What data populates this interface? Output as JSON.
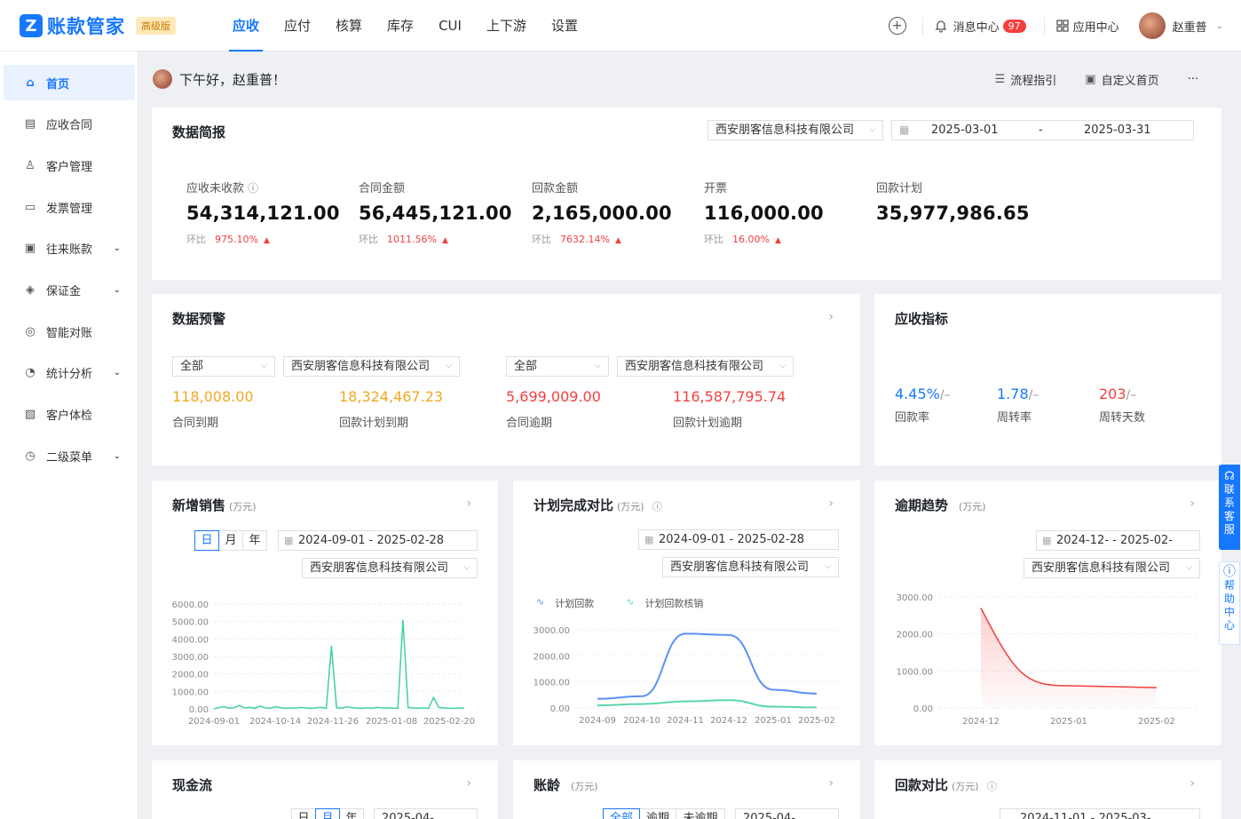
{
  "brand": {
    "logo_letter": "Z",
    "name": "账款管家",
    "edition": "高级版"
  },
  "nav": [
    "应收",
    "应付",
    "核算",
    "库存",
    "CUI",
    "上下游",
    "设置"
  ],
  "header": {
    "plus": "+",
    "msg_label": "消息中心",
    "msg_count": "97",
    "app_label": "应用中心",
    "user_name": "赵重普"
  },
  "sidebar": [
    {
      "label": "首页",
      "icon": "home-icon",
      "glyph": "⌂"
    },
    {
      "label": "应收合同",
      "icon": "contract-icon",
      "glyph": "▤"
    },
    {
      "label": "客户管理",
      "icon": "user-icon",
      "glyph": "♙"
    },
    {
      "label": "发票管理",
      "icon": "invoice-icon",
      "glyph": "▭"
    },
    {
      "label": "往来账款",
      "icon": "ledger-icon",
      "glyph": "▣",
      "chev": "⌄"
    },
    {
      "label": "保证金",
      "icon": "deposit-icon",
      "glyph": "◈",
      "chev": "⌄"
    },
    {
      "label": "智能对账",
      "icon": "reconcile-icon",
      "glyph": "◎"
    },
    {
      "label": "统计分析",
      "icon": "chart-icon",
      "glyph": "◔",
      "chev": "⌄"
    },
    {
      "label": "客户体检",
      "icon": "checkup-icon",
      "glyph": "▧"
    },
    {
      "label": "二级菜单",
      "icon": "clock-icon",
      "glyph": "◷",
      "chev": "⌄"
    }
  ],
  "greeting": "下午好，赵重普！",
  "actions": {
    "guide": "流程指引",
    "custom": "自定义首页",
    "more": "···"
  },
  "brief": {
    "title": "数据简报",
    "company": "西安朋客信息科技有限公司",
    "date_start": "2025-03-01",
    "date_sep": "-",
    "date_end": "2025-03-31",
    "metrics": [
      {
        "label": "应收未收款",
        "value": "54,314,121.00",
        "cmp": "环比",
        "pct": "975.10%",
        "up": "▲"
      },
      {
        "label": "合同金额",
        "value": "56,445,121.00",
        "cmp": "环比",
        "pct": "1011.56%",
        "up": "▲"
      },
      {
        "label": "回款金额",
        "value": "2,165,000.00",
        "cmp": "环比",
        "pct": "7632.14%",
        "up": "▲"
      },
      {
        "label": "开票",
        "value": "116,000.00",
        "cmp": "环比",
        "pct": "16.00%",
        "up": "▲"
      },
      {
        "label": "回款计划",
        "value": "35,977,986.65"
      }
    ]
  },
  "warning": {
    "title": "数据预警",
    "filter1": "全部",
    "company1": "西安朋客信息科技有限公司",
    "filter2": "全部",
    "company2": "西安朋客信息科技有限公司",
    "items": [
      {
        "value": "118,008.00",
        "label": "合同到期",
        "color": "#f5a623"
      },
      {
        "value": "18,324,467.23",
        "label": "回款计划到期",
        "color": "#f5a623"
      },
      {
        "value": "5,699,009.00",
        "label": "合同逾期",
        "color": "#f53f3f"
      },
      {
        "value": "116,587,795.74",
        "label": "回款计划逾期",
        "color": "#f53f3f"
      }
    ]
  },
  "indicators": {
    "title": "应收指标",
    "items": [
      {
        "value": "4.45%",
        "suffix": "/–",
        "label": "回款率",
        "color": "#1677ff"
      },
      {
        "value": "1.78",
        "suffix": "/–",
        "label": "周转率",
        "color": "#1677ff"
      },
      {
        "value": "203",
        "suffix": "/–",
        "label": "周转天数",
        "color": "#f53f3f"
      }
    ]
  },
  "sales": {
    "title": "新增销售",
    "unit": "(万元)",
    "seg": [
      "日",
      "月",
      "年"
    ],
    "date": "2024-09-01  -  2025-02-28",
    "company": "西安朋客信息科技有限公司"
  },
  "plan": {
    "title": "计划完成对比",
    "unit": "(万元)",
    "date": "2024-09-01  -  2025-02-28",
    "company": "西安朋客信息科技有限公司",
    "legend": [
      "计划回款",
      "计划回款核销"
    ]
  },
  "overdue": {
    "title": "逾期趋势",
    "unit": "(万元)",
    "date": "2024-12-  -  2025-02-",
    "company": "西安朋客信息科技有限公司"
  },
  "cash": {
    "title": "现金流",
    "seg": [
      "日",
      "月",
      "年"
    ],
    "date": "2025-04-"
  },
  "aging": {
    "title": "账龄",
    "unit": "(万元)",
    "seg": [
      "全部",
      "逾期",
      "未逾期"
    ],
    "date": "2025-04-"
  },
  "compare": {
    "title": "回款对比",
    "unit": "(万元)",
    "date": "2024-11-01  -  2025-03-"
  },
  "float": {
    "service": "联系客服",
    "help": "帮助中心"
  },
  "chart_data": [
    {
      "type": "line",
      "title": "新增销售",
      "ylim": [
        0,
        6000
      ],
      "yticks": [
        "6000.00",
        "5000.00",
        "4000.00",
        "3000.00",
        "2000.00",
        "1000.00",
        "0.00"
      ],
      "xticks": [
        "2024-09-01",
        "2024-10-14",
        "2024-11-26",
        "2025-01-08",
        "2025-02-20"
      ],
      "color": "#3fd1a0",
      "values": [
        0,
        80,
        120,
        40,
        60,
        200,
        50,
        90,
        30,
        150,
        60,
        40,
        120,
        70,
        30,
        60,
        40,
        80,
        50,
        30,
        60,
        90,
        40,
        3600,
        60,
        40,
        120,
        70,
        50,
        30,
        60,
        40,
        80,
        50,
        60,
        40,
        30,
        5100,
        80,
        50,
        40,
        60,
        30,
        650,
        80,
        60,
        40,
        30,
        50,
        40
      ]
    },
    {
      "type": "line",
      "title": "计划完成对比",
      "ylim": [
        0,
        3000
      ],
      "yticks": [
        "3000.00",
        "2000.00",
        "1000.00",
        "0.00"
      ],
      "xticks": [
        "2024-09",
        "2024-10",
        "2024-11",
        "2024-12",
        "2025-01",
        "2025-02"
      ],
      "series": [
        {
          "name": "计划回款",
          "color": "#5b8ff9",
          "values": [
            350,
            450,
            2850,
            2800,
            700,
            550
          ]
        },
        {
          "name": "计划回款核销",
          "color": "#5ad8a6",
          "values": [
            100,
            150,
            250,
            300,
            50,
            20
          ]
        }
      ]
    },
    {
      "type": "area",
      "title": "逾期趋势",
      "ylim": [
        0,
        3000
      ],
      "yticks": [
        "3000.00",
        "2000.00",
        "1000.00",
        "0.00"
      ],
      "xticks": [
        "2024-12",
        "2025-01",
        "2025-02"
      ],
      "color": "#f53f3f",
      "values": [
        2700,
        600,
        550
      ]
    }
  ]
}
